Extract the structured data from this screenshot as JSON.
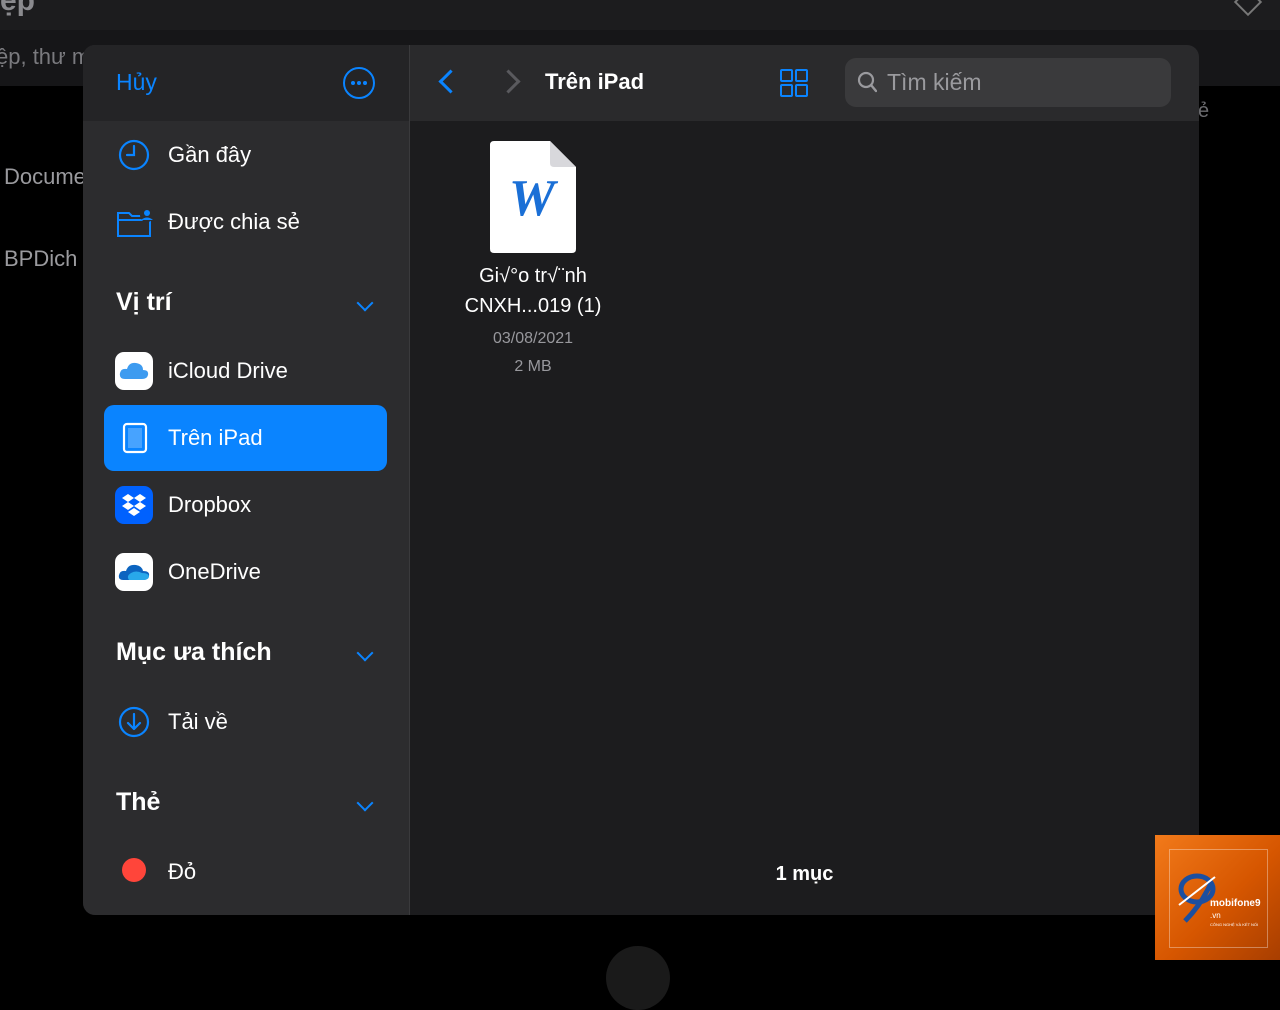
{
  "background": {
    "title": "ệp",
    "search_text": "ệp, thư m",
    "items": [
      "Docume",
      "BPDich"
    ],
    "right_fragment": "ẻ"
  },
  "sidebar": {
    "cancel_label": "Hủy",
    "more_icon": "ellipsis-circle-icon",
    "quick_items": [
      {
        "label": "Gần đây",
        "icon": "clock-icon"
      },
      {
        "label": "Được chia sẻ",
        "icon": "shared-folder-icon"
      }
    ],
    "sections": [
      {
        "title": "Vị trí",
        "items": [
          {
            "label": "iCloud Drive",
            "icon": "icloud-icon"
          },
          {
            "label": "Trên iPad",
            "icon": "ipad-icon",
            "selected": true
          },
          {
            "label": "Dropbox",
            "icon": "dropbox-icon"
          },
          {
            "label": "OneDrive",
            "icon": "onedrive-icon"
          }
        ]
      },
      {
        "title": "Mục ưa thích",
        "items": [
          {
            "label": "Tải về",
            "icon": "download-icon"
          }
        ]
      },
      {
        "title": "Thẻ",
        "items": [
          {
            "label": "Đỏ",
            "icon": "red-tag-icon",
            "color": "#ff453a"
          }
        ]
      }
    ]
  },
  "main": {
    "title": "Trên iPad",
    "search_placeholder": "Tìm kiếm",
    "files": [
      {
        "name_line1": "Gi√°o tr√¨nh",
        "name_line2": "CNXH...019 (1)",
        "date": "03/08/2021",
        "size": "2 MB",
        "icon": "word-document-icon"
      }
    ],
    "item_count": "1 mục"
  },
  "watermark": {
    "brand": "mobifone9",
    "domain": ".vn",
    "tagline": "CÔNG NGHỆ VÀ KẾT NỐI"
  },
  "colors": {
    "accent": "#0a84ff",
    "sidebar_bg": "#2c2c2e",
    "main_bg": "#1c1c1e",
    "tag_red": "#ff453a"
  }
}
